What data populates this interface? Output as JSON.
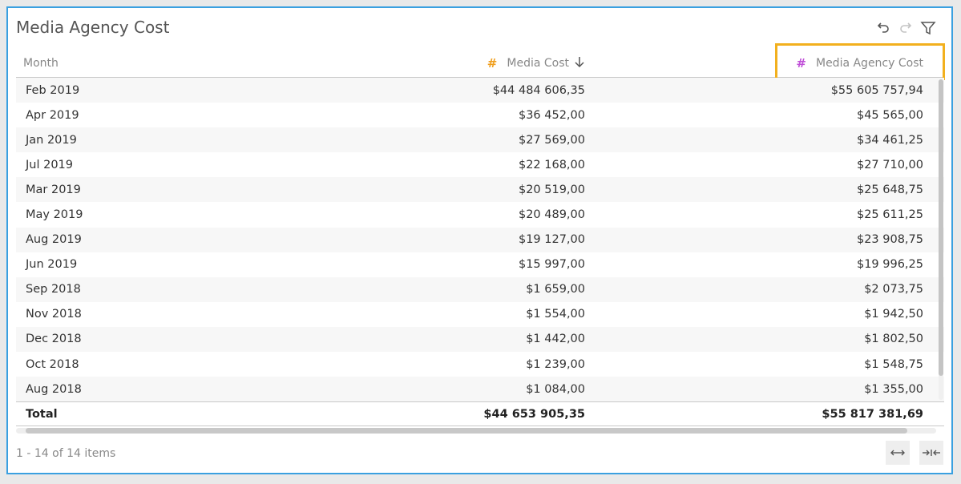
{
  "widget": {
    "title": "Media Agency Cost",
    "icons": {
      "undo": "undo-icon",
      "redo": "redo-icon",
      "filter": "filter-icon"
    }
  },
  "columns": {
    "month": "Month",
    "media_cost": "Media Cost",
    "media_agency_cost": "Media Agency Cost",
    "hash_symbol": "#",
    "sort_indicator": "arrow-down-icon"
  },
  "colors": {
    "border": "#3aa0e0",
    "highlight": "#f2b01e",
    "hash_media": "#f0a020",
    "hash_agency": "#c050d8"
  },
  "rows": [
    {
      "month": "Feb 2019",
      "media_cost": "$44 484 606,35",
      "agency_cost": "$55 605 757,94"
    },
    {
      "month": "Apr 2019",
      "media_cost": "$36 452,00",
      "agency_cost": "$45 565,00"
    },
    {
      "month": "Jan 2019",
      "media_cost": "$27 569,00",
      "agency_cost": "$34 461,25"
    },
    {
      "month": "Jul 2019",
      "media_cost": "$22 168,00",
      "agency_cost": "$27 710,00"
    },
    {
      "month": "Mar 2019",
      "media_cost": "$20 519,00",
      "agency_cost": "$25 648,75"
    },
    {
      "month": "May 2019",
      "media_cost": "$20 489,00",
      "agency_cost": "$25 611,25"
    },
    {
      "month": "Aug 2019",
      "media_cost": "$19 127,00",
      "agency_cost": "$23 908,75"
    },
    {
      "month": "Jun 2019",
      "media_cost": "$15 997,00",
      "agency_cost": "$19 996,25"
    },
    {
      "month": "Sep 2018",
      "media_cost": "$1 659,00",
      "agency_cost": "$2 073,75"
    },
    {
      "month": "Nov 2018",
      "media_cost": "$1 554,00",
      "agency_cost": "$1 942,50"
    },
    {
      "month": "Dec 2018",
      "media_cost": "$1 442,00",
      "agency_cost": "$1 802,50"
    },
    {
      "month": "Oct 2018",
      "media_cost": "$1 239,00",
      "agency_cost": "$1 548,75"
    },
    {
      "month": "Aug 2018",
      "media_cost": "$1 084,00",
      "agency_cost": "$1 355,00"
    }
  ],
  "total": {
    "label": "Total",
    "media_cost": "$44 653 905,35",
    "agency_cost": "$55 817 381,69"
  },
  "footer": {
    "items_text": "1 - 14 of 14 items",
    "expand_icon": "expand-columns-icon",
    "collapse_icon": "collapse-columns-icon"
  }
}
